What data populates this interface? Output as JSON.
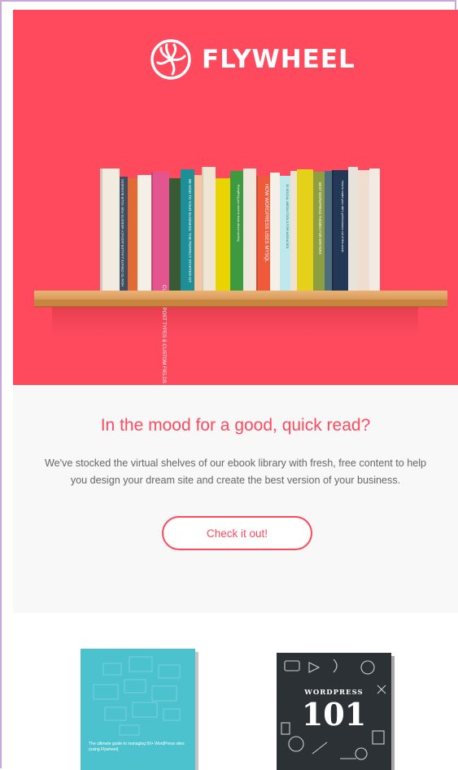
{
  "brand": {
    "name": "FLYWHEEL",
    "logo_icon": "flywheel-swirl-icon",
    "hero_color": "#ff4a5e"
  },
  "hero": {
    "image": "bookshelf-illustration",
    "spines": [
      "HOW TO CREATE A KILLER AGENCY WEBSITE FOR YOUR BUSINESS",
      "CUSTOM POST TYPES & CUSTOM FIELDS",
      "BE KIND TO YOUR BUSINESS: THE PERFECT STARTER KIT",
      "Everything you need to know about caching",
      "HOW WORDPRESS USES MYSQL",
      "35 SOCIAL MEDIA TOOLS FOR AGENCIES",
      "BEST WORDPRESS THEMES FOR WRITERS",
      "How to make your site's performance out of this world"
    ]
  },
  "content": {
    "headline": "In the mood for a good, quick read?",
    "body": "We've stocked the virtual shelves of our ebook library with fresh, free content to help you design your dream site and create the best version of your business.",
    "cta_label": "Check it out!"
  },
  "books": [
    {
      "cover_color": "#4dc2cf",
      "caption": "The ultimate guide to managing 50+ WordPress sites (using Flywheel)"
    },
    {
      "cover_color": "#2b3134",
      "title": "WORDPRESS",
      "number": "101"
    }
  ]
}
